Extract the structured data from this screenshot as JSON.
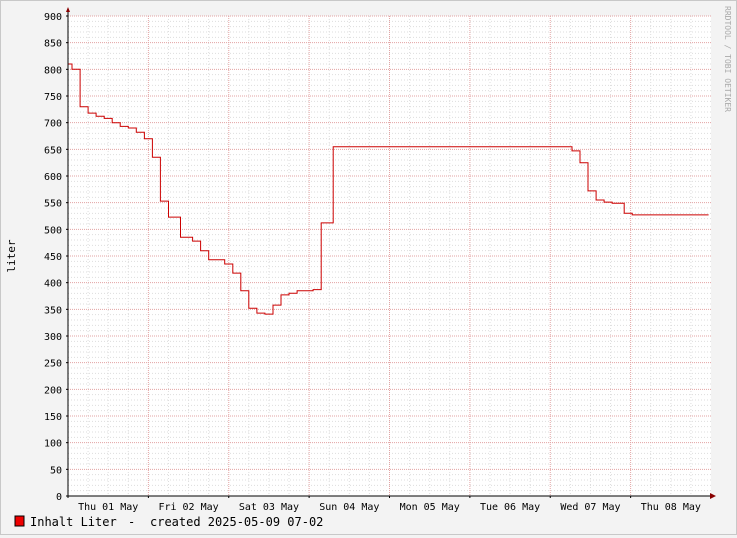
{
  "chart_data": {
    "type": "line",
    "title": "",
    "xlabel": "",
    "ylabel": "liter",
    "watermark": "RRDTOOL / TOBI OETIKER",
    "ylim": [
      0,
      900
    ],
    "yticks": [
      0,
      50,
      100,
      150,
      200,
      250,
      300,
      350,
      400,
      450,
      500,
      550,
      600,
      650,
      700,
      750,
      800,
      850,
      900
    ],
    "xrange_days": [
      0,
      8
    ],
    "xticks": [
      {
        "day": 0,
        "label": "Thu 01 May"
      },
      {
        "day": 1,
        "label": "Fri 02 May"
      },
      {
        "day": 2,
        "label": "Sat 03 May"
      },
      {
        "day": 3,
        "label": "Sun 04 May"
      },
      {
        "day": 4,
        "label": "Mon 05 May"
      },
      {
        "day": 5,
        "label": "Tue 06 May"
      },
      {
        "day": 6,
        "label": "Wed 07 May"
      },
      {
        "day": 7,
        "label": "Thu 08 May"
      }
    ],
    "grid": true,
    "series": [
      {
        "name": "Inhalt Liter",
        "color": "#cc0000",
        "step": true,
        "x": [
          0.0,
          0.05,
          0.15,
          0.25,
          0.35,
          0.45,
          0.55,
          0.65,
          0.75,
          0.85,
          0.95,
          1.05,
          1.15,
          1.25,
          1.4,
          1.55,
          1.65,
          1.75,
          1.95,
          2.05,
          2.15,
          2.25,
          2.35,
          2.45,
          2.55,
          2.65,
          2.75,
          2.85,
          3.05,
          3.15,
          3.3,
          3.43,
          6.27,
          6.37,
          6.47,
          6.57,
          6.67,
          6.77,
          6.92,
          7.02,
          7.12,
          7.97
        ],
        "values": [
          810,
          800,
          730,
          718,
          712,
          708,
          700,
          693,
          690,
          682,
          670,
          635,
          553,
          523,
          485,
          478,
          460,
          443,
          435,
          418,
          385,
          352,
          343,
          341,
          358,
          377,
          380,
          385,
          387,
          512,
          655,
          655,
          647,
          625,
          572,
          555,
          551,
          549,
          530,
          527,
          527,
          527
        ]
      }
    ],
    "legend": {
      "position": "bottom-left",
      "created_text": "created 2025-05-09 07-02",
      "separator": "-"
    }
  }
}
